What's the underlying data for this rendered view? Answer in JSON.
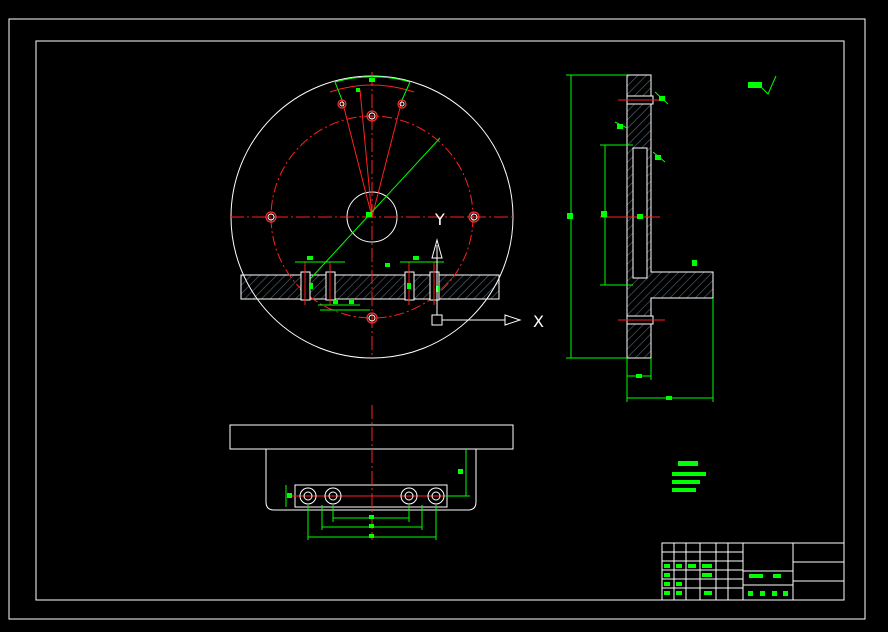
{
  "canvas": {
    "background": "#000000"
  },
  "colors": {
    "outline": "#ffffff",
    "dimension": "#00ff00",
    "centerline": "#ff2020",
    "hatch": "#5a6a78",
    "hole_ring": "#ff3030"
  },
  "ucs": {
    "x_label": "X",
    "y_label": "Y"
  },
  "views": [
    "front-view",
    "side-section-view",
    "bottom-view"
  ],
  "title_block": {
    "present": true
  }
}
